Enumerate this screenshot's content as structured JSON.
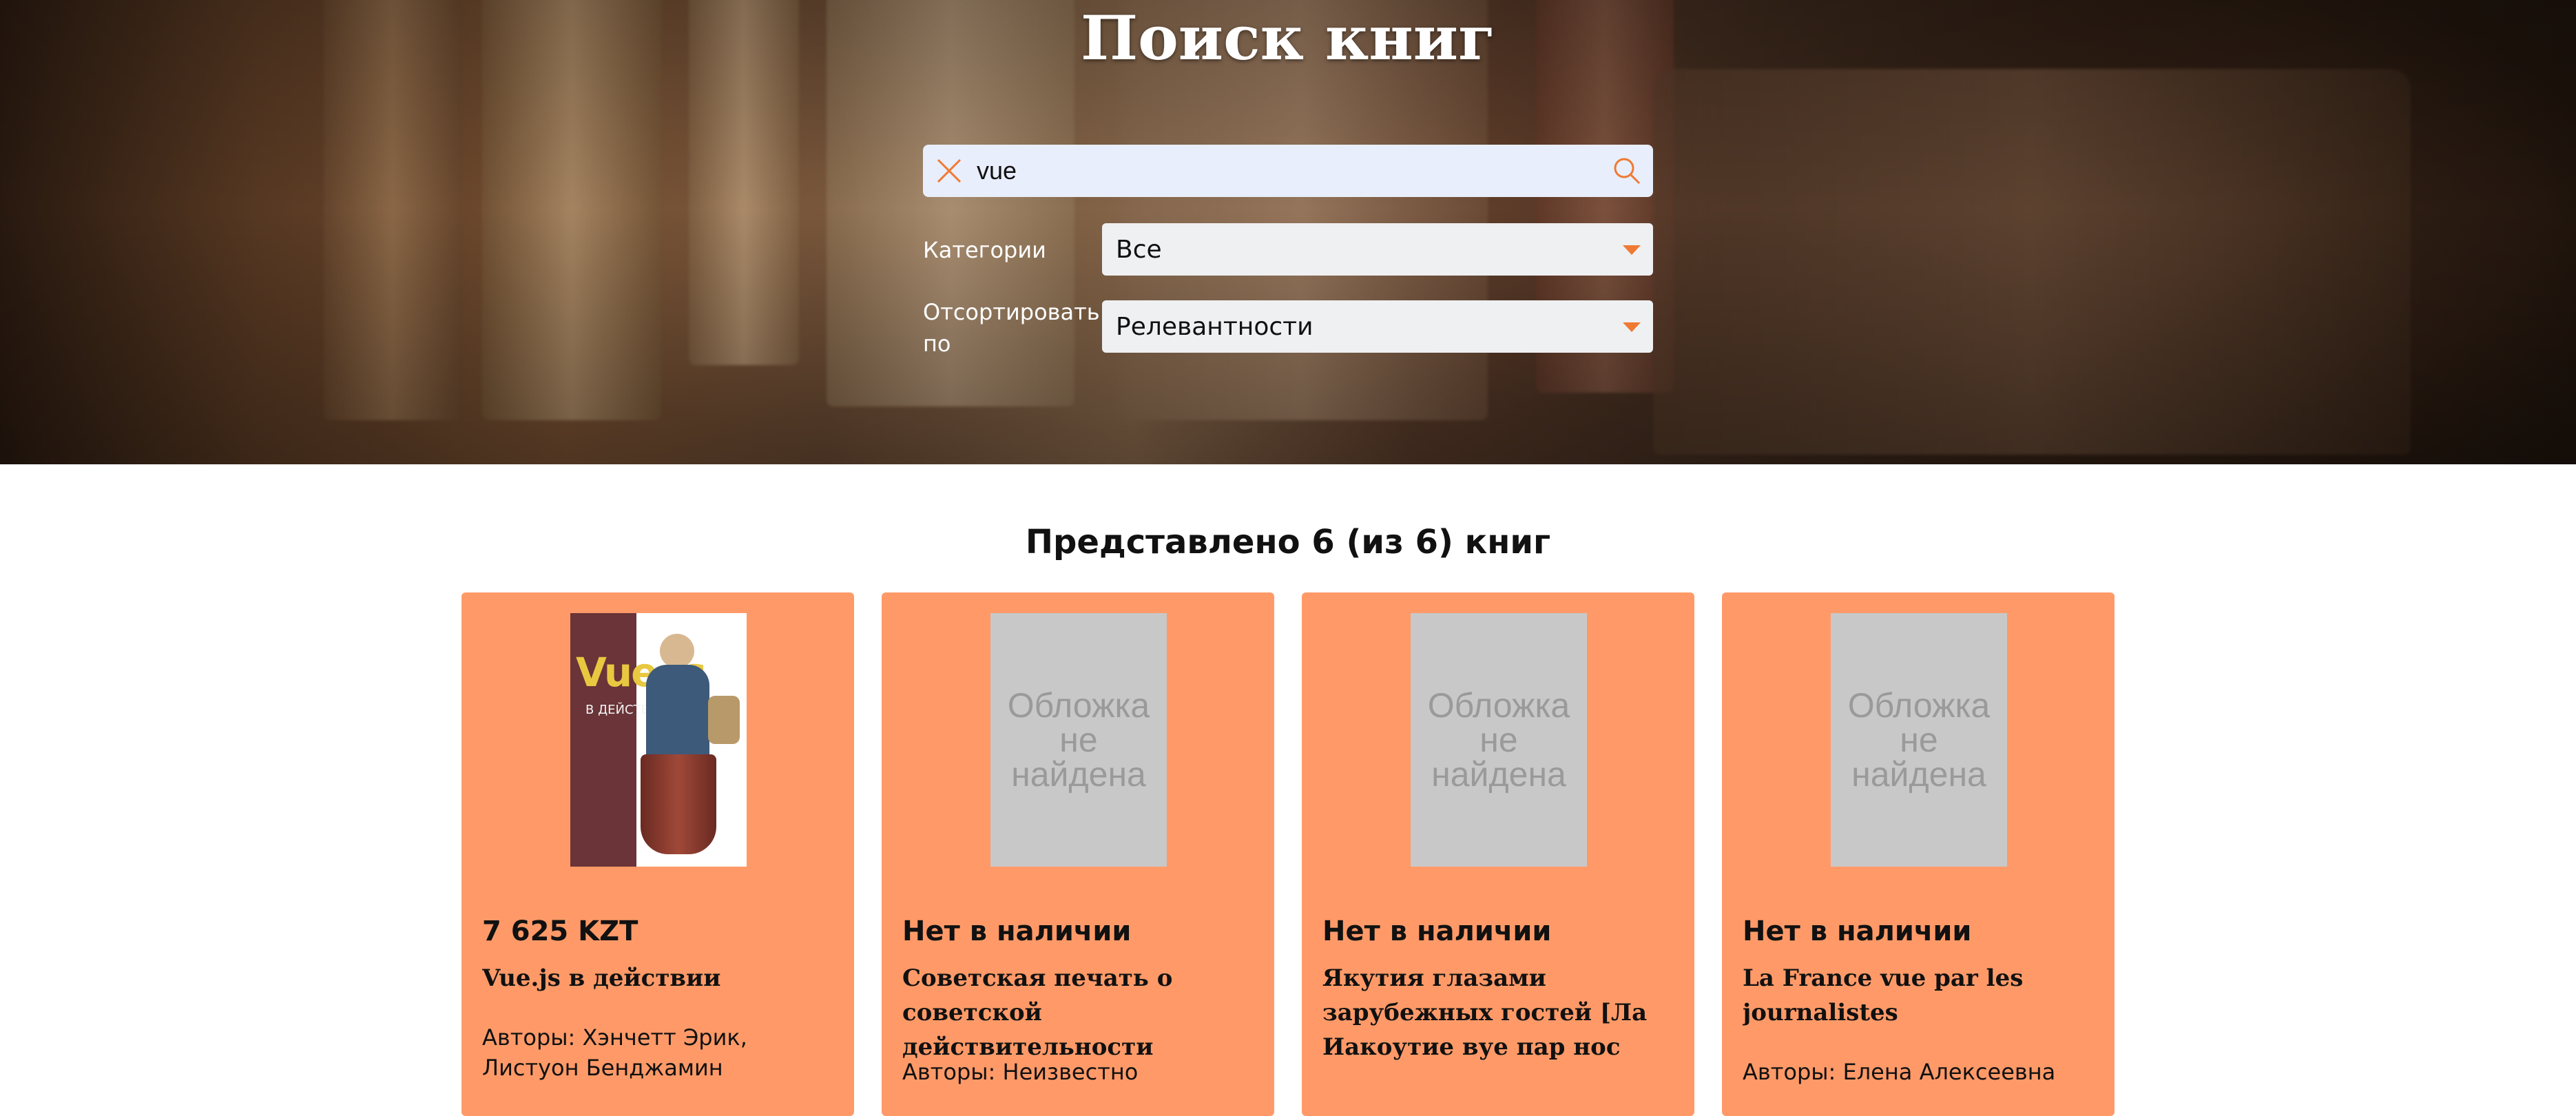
{
  "header": {
    "title": "Поиск книг"
  },
  "search": {
    "value": "vue",
    "clear_icon": "close-icon",
    "search_icon": "search-icon"
  },
  "filters": {
    "category_label": "Категории",
    "category_value": "Все",
    "sort_label_line1": "Отсортировать",
    "sort_label_line2": "по",
    "sort_value": "Релевантности"
  },
  "colors": {
    "accent": "#f07a33",
    "card_bg": "#ff9a68",
    "search_bg": "#e8eefb"
  },
  "results": {
    "summary": "Представлено 6 (из 6) книг",
    "cards": [
      {
        "price": "7 625 KZT",
        "title": "Vue.js в действии",
        "authors": "Авторы: Хэнчетт Эрик, Листуон Бенджамин",
        "cover_title": "Vue.js",
        "cover_subtitle": "В ДЕЙСТВИИ"
      },
      {
        "price": "Нет в наличии",
        "title": "Советская печать о советской действительности",
        "authors": "Авторы: Неизвестно",
        "cover_placeholder": "Обложка не найдена"
      },
      {
        "price": "Нет в наличии",
        "title": "Якутия глазами зарубежных гостей [Ла Иакоутие вуе пар нос инви…",
        "authors": "",
        "cover_placeholder": "Обложка не найдена"
      },
      {
        "price": "Нет в наличии",
        "title": "La France vue par les journalistes",
        "authors": "Авторы: Елена Алексеевна",
        "cover_placeholder": "Обложка не найдена"
      }
    ]
  }
}
